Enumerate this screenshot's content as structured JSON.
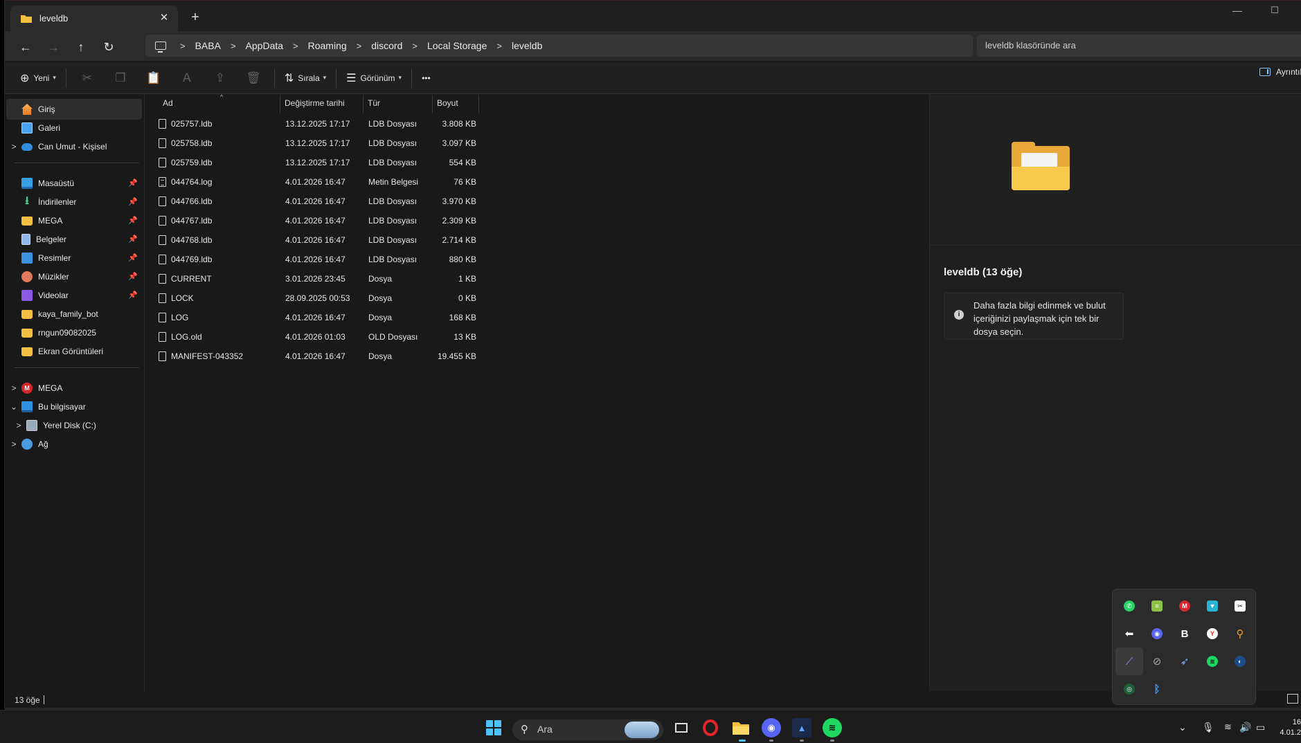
{
  "tab": {
    "title": "leveldb",
    "close": "✕",
    "new": "+"
  },
  "window_controls": {
    "minimize": "—",
    "maximize": "☐"
  },
  "nav": {
    "breadcrumbs": [
      "BABA",
      "AppData",
      "Roaming",
      "discord",
      "Local Storage",
      "leveldb"
    ],
    "search_placeholder": "leveldb klasöründe ara"
  },
  "commands": {
    "new_label": "Yeni",
    "sort_label": "Sırala",
    "view_label": "Görünüm",
    "more_label": "•••",
    "details_label": "Ayrıntılar"
  },
  "sidebar": {
    "items": [
      {
        "label": "Giriş",
        "icon": "home-icon"
      },
      {
        "label": "Galeri",
        "icon": "gallery-icon"
      },
      {
        "label": "Can Umut - Kişisel",
        "icon": "onedrive-cloud-icon"
      },
      {
        "label": "Masaüstü",
        "icon": "desktop-icon"
      },
      {
        "label": "İndirilenler",
        "icon": "download-icon"
      },
      {
        "label": "MEGA",
        "icon": "folder-icon"
      },
      {
        "label": "Belgeler",
        "icon": "documents-icon"
      },
      {
        "label": "Resimler",
        "icon": "pictures-icon"
      },
      {
        "label": "Müzikler",
        "icon": "music-icon"
      },
      {
        "label": "Videolar",
        "icon": "videos-icon"
      },
      {
        "label": "kaya_family_bot",
        "icon": "folder-icon"
      },
      {
        "label": "rngun09082025",
        "icon": "folder-icon"
      },
      {
        "label": "Ekran Görüntüleri",
        "icon": "folder-icon"
      },
      {
        "label": "MEGA",
        "icon": "mega-icon"
      },
      {
        "label": "Bu bilgisayar",
        "icon": "this-pc-icon"
      },
      {
        "label": "Yerel Disk (C:)",
        "icon": "disk-icon"
      },
      {
        "label": "Ağ",
        "icon": "network-icon"
      }
    ]
  },
  "columns": {
    "name": "Ad",
    "date": "Değiştirme tarihi",
    "type": "Tür",
    "size": "Boyut"
  },
  "files": [
    {
      "name": "025757.ldb",
      "date": "13.12.2025 17:17",
      "type": "LDB Dosyası",
      "size": "3.808 KB"
    },
    {
      "name": "025758.ldb",
      "date": "13.12.2025 17:17",
      "type": "LDB Dosyası",
      "size": "3.097 KB"
    },
    {
      "name": "025759.ldb",
      "date": "13.12.2025 17:17",
      "type": "LDB Dosyası",
      "size": "554 KB"
    },
    {
      "name": "044764.log",
      "date": "4.01.2026 16:47",
      "type": "Metin Belgesi",
      "size": "76 KB"
    },
    {
      "name": "044766.ldb",
      "date": "4.01.2026 16:47",
      "type": "LDB Dosyası",
      "size": "3.970 KB"
    },
    {
      "name": "044767.ldb",
      "date": "4.01.2026 16:47",
      "type": "LDB Dosyası",
      "size": "2.309 KB"
    },
    {
      "name": "044768.ldb",
      "date": "4.01.2026 16:47",
      "type": "LDB Dosyası",
      "size": "2.714 KB"
    },
    {
      "name": "044769.ldb",
      "date": "4.01.2026 16:47",
      "type": "LDB Dosyası",
      "size": "880 KB"
    },
    {
      "name": "CURRENT",
      "date": "3.01.2026 23:45",
      "type": "Dosya",
      "size": "1 KB"
    },
    {
      "name": "LOCK",
      "date": "28.09.2025 00:53",
      "type": "Dosya",
      "size": "0 KB"
    },
    {
      "name": "LOG",
      "date": "4.01.2026 16:47",
      "type": "Dosya",
      "size": "168 KB"
    },
    {
      "name": "LOG.old",
      "date": "4.01.2026 01:03",
      "type": "OLD Dosyası",
      "size": "13 KB"
    },
    {
      "name": "MANIFEST-043352",
      "date": "4.01.2026 16:47",
      "type": "Dosya",
      "size": "19.455 KB"
    }
  ],
  "details": {
    "title": "leveldb (13 öğe)",
    "info": "Daha fazla bilgi edinmek ve bulut içeriğinizi paylaşmak için tek bir dosya seçin."
  },
  "status": {
    "count": "13 öğe"
  },
  "taskbar": {
    "search_label": "Ara",
    "clock_time": "16",
    "clock_date": "4.01.2"
  },
  "tray_icons": [
    "whatsapp-icon",
    "bluestacks-icon",
    "mega-sync-icon",
    "vpn-shield-icon",
    "capcut-icon",
    "back-arrow-icon",
    "discord-icon",
    "b-app-icon",
    "yandex-icon",
    "search-tool-icon",
    "feather-app-icon",
    "hidden-eye-icon",
    "rocket-icon",
    "spotify-icon",
    "steam-icon",
    "nvidia-icon",
    "bluetooth-icon"
  ],
  "colors": {
    "accent": "#4cc2ff",
    "folder": "#f3c041",
    "window_bg": "#191919"
  }
}
